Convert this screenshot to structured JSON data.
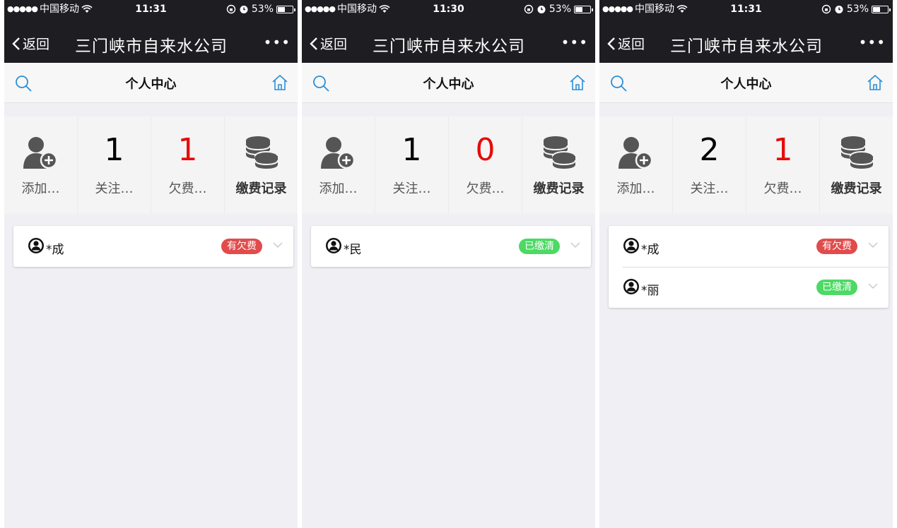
{
  "colors": {
    "owing": "#e24b4b",
    "paid": "#4cd964",
    "accent": "#2b8fd6",
    "red_number": "#e60b0b"
  },
  "phones": [
    {
      "status": {
        "signal": "●●●●●",
        "carrier": "中国移动",
        "time": "11:31",
        "battery": "53%"
      },
      "nav": {
        "back": "返回",
        "title": "三门峡市自来水公司",
        "more": "•••"
      },
      "header": {
        "title": "个人中心"
      },
      "stats": {
        "add_label": "添加…",
        "follow_count": "1",
        "follow_label": "关注…",
        "owe_count": "1",
        "owe_label": "欠费…",
        "records_label": "缴费记录"
      },
      "accounts": [
        {
          "name": "*成",
          "status": "有欠费",
          "status_type": "owing"
        }
      ]
    },
    {
      "status": {
        "signal": "●●●●●",
        "carrier": "中国移动",
        "time": "11:30",
        "battery": "53%"
      },
      "nav": {
        "back": "返回",
        "title": "三门峡市自来水公司",
        "more": "•••"
      },
      "header": {
        "title": "个人中心"
      },
      "stats": {
        "add_label": "添加…",
        "follow_count": "1",
        "follow_label": "关注…",
        "owe_count": "0",
        "owe_label": "欠费…",
        "records_label": "缴费记录"
      },
      "accounts": [
        {
          "name": "*民",
          "status": "已缴清",
          "status_type": "paid"
        }
      ]
    },
    {
      "status": {
        "signal": "●●●●●",
        "carrier": "中国移动",
        "time": "11:31",
        "battery": "53%"
      },
      "nav": {
        "back": "返回",
        "title": "三门峡市自来水公司",
        "more": "•••"
      },
      "header": {
        "title": "个人中心"
      },
      "stats": {
        "add_label": "添加…",
        "follow_count": "2",
        "follow_label": "关注…",
        "owe_count": "1",
        "owe_label": "欠费…",
        "records_label": "缴费记录"
      },
      "accounts": [
        {
          "name": "*成",
          "status": "有欠费",
          "status_type": "owing"
        },
        {
          "name": "*丽",
          "status": "已缴清",
          "status_type": "paid"
        }
      ]
    }
  ]
}
